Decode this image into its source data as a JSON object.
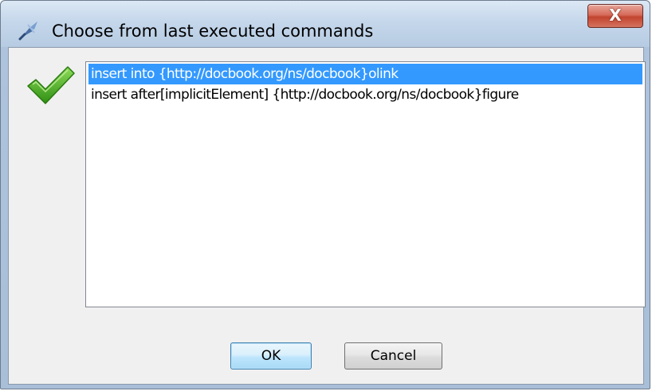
{
  "window": {
    "title": "Choose from last executed commands",
    "close_label": "X"
  },
  "commands": [
    {
      "label": "insert into {http://docbook.org/ns/docbook}olink",
      "selected": true
    },
    {
      "label": "insert after[implicitElement] {http://docbook.org/ns/docbook}figure",
      "selected": false
    }
  ],
  "buttons": {
    "ok_label": "OK",
    "cancel_label": "Cancel"
  },
  "icons": {
    "app": "oxygen-pin-icon",
    "status": "green-checkmark-icon"
  },
  "colors": {
    "selection": "#3399ff",
    "close_button": "#c2442f",
    "check": "#3aa619"
  }
}
